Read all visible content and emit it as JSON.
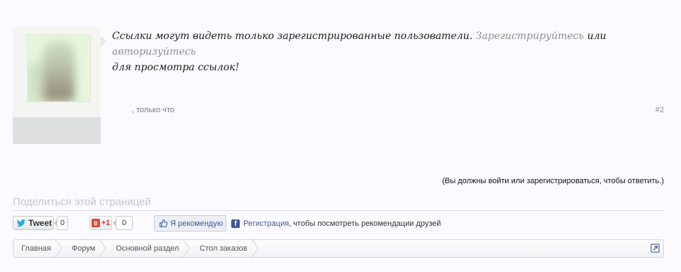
{
  "post": {
    "message_text": "Ссылки могут видеть только зарегистрированные пользователи.",
    "register_link": "Зарегистрируйтесь",
    "or_text": "или",
    "login_link": "авторизуйтесь",
    "message_suffix": "для просмотра ссылок!",
    "meta": ", только что",
    "number": "#2"
  },
  "reply_note": "(Вы должны войти или зарегистрироваться, чтобы ответить.)",
  "share": {
    "title": "Поделиться этой страницей",
    "tweet_label": "Tweet",
    "tweet_count": "0",
    "gplus_label": "+1",
    "gplus_count": "0",
    "like_label": "Я рекомендую",
    "fb_register_link": "Регистрация",
    "fb_text": ", чтобы посмотреть рекомендации друзей"
  },
  "breadcrumb": {
    "items": [
      {
        "label": "Главная"
      },
      {
        "label": "Форум"
      },
      {
        "label": "Основной раздел"
      },
      {
        "label": "Стол заказов"
      }
    ]
  },
  "icons": {
    "twitter": "twitter-bird-icon",
    "gplus": "google-plus-icon",
    "like": "thumbs-up-icon",
    "facebook": "facebook-icon",
    "jump": "jump-to-page-icon"
  },
  "colors": {
    "link": "#8d8d8d",
    "facebook": "#3b5998",
    "gplus": "#dd4b39",
    "twitter": "#2aa9e0"
  }
}
